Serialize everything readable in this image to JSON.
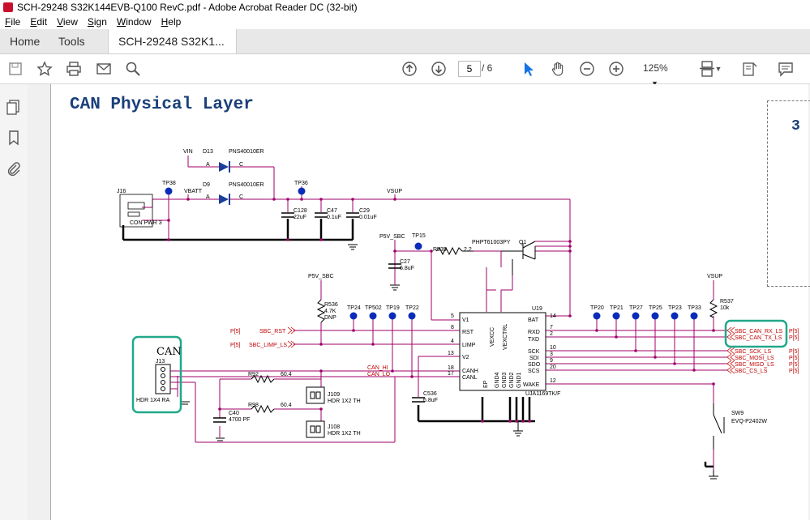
{
  "window": {
    "title": "SCH-29248 S32K144EVB-Q100 RevC.pdf - Adobe Acrobat Reader DC (32-bit)"
  },
  "menu": [
    "File",
    "Edit",
    "View",
    "Sign",
    "Window",
    "Help"
  ],
  "tabs": {
    "home": "Home",
    "tools": "Tools",
    "doc": "SCH-29248 S32K1...",
    "close": "×"
  },
  "toolbar": {
    "page_current": "5",
    "page_total": "/ 6",
    "zoom": "125%"
  },
  "page": {
    "title": "CAN Physical Layer",
    "ghost_number": "3"
  },
  "schematic": {
    "top": {
      "vin": "VIN",
      "d13": "D13",
      "pn1": "PNS40010ER",
      "d9": "D9",
      "pn2": "PNS40010ER",
      "a1": "A",
      "c1": "C",
      "a2": "A",
      "c2": "C",
      "vbatt": "VBATT",
      "tp38": "TP38",
      "tp36": "TP36",
      "vsup": "VSUP",
      "j16": "J16",
      "conpwr": "CON PWR 3",
      "c128": "C128",
      "c128v": "22uF",
      "c47": "C47",
      "c47v": "0.1uF",
      "c29": "C29",
      "c29v": "0.01uF"
    },
    "mid": {
      "p5v": "P5V_SBC",
      "tp15": "TP15",
      "c27": "C27",
      "c27v": "6.8uF",
      "r535": "R535",
      "r535v": "2.2",
      "phpt": "PHPT61003PY",
      "q1": "Q1",
      "p5v2": "P5V_SBC",
      "r536": "R536",
      "r536v": "4.7K",
      "dnp": "DNP",
      "vsup2": "VSUP",
      "r537": "R537",
      "r537v": "10k"
    },
    "tps": [
      "TP24",
      "TP502",
      "TP19",
      "TP22",
      "TP20",
      "TP21",
      "TP27",
      "TP25",
      "TP23",
      "TP33"
    ],
    "ic": {
      "ref": "U19",
      "part": "UJA1169TK/F",
      "pins_left": [
        "V1",
        "RST",
        "LIMP",
        "V2",
        "CANH",
        "CANL"
      ],
      "pins_right": [
        "BAT",
        "RXD",
        "TXD",
        "SCK",
        "SDI",
        "SDO",
        "SCS",
        "WAKE"
      ],
      "pin_nums_left": [
        "5",
        "8",
        "4",
        "13",
        "18",
        "17"
      ],
      "pin_nums_right": [
        "14",
        "7",
        "2",
        "10",
        "3",
        "9",
        "20",
        "12"
      ],
      "vexcc": "VEXCC",
      "vexctrl": "VEXCTRL",
      "ep": "EP",
      "gnds": [
        "GND4",
        "GND3",
        "GND2",
        "GND1"
      ]
    },
    "nets_left": {
      "rst": "SBC_RST",
      "limp": "SBC_LIMP_LS",
      "p1": "P[5]",
      "p2": "P[5]",
      "canh": "CAN_HI",
      "canl": "CAN_LO"
    },
    "nets_right": [
      {
        "net": "SBC_CAN_RX_LS",
        "ref": "P[5]"
      },
      {
        "net": "SBC_CAN_TX_LS",
        "ref": "P[5]"
      },
      {
        "net": "SBC_SCK_LS",
        "ref": "P[5]"
      },
      {
        "net": "SBC_MOSI_LS",
        "ref": "P[5]"
      },
      {
        "net": "SBC_MISO_LS",
        "ref": "P[5]"
      },
      {
        "net": "SBC_CS_LS",
        "ref": "P[5]"
      }
    ],
    "can": {
      "label": "CAN",
      "j13": "J13",
      "hdr": "HDR 1X4 RA",
      "r92": "R92",
      "r92v": "60.4",
      "r98": "R98",
      "r98v": "60.4",
      "c40": "C40",
      "c40v": "4700 PF",
      "j109": "J109",
      "j108": "J108",
      "hdr2a": "HDR 1X2 TH",
      "hdr2b": "HDR 1X2 TH",
      "c536": "C536",
      "c536v": "6.8uF"
    },
    "sw": {
      "ref": "SW9",
      "part": "EVQ-P2402W"
    }
  }
}
